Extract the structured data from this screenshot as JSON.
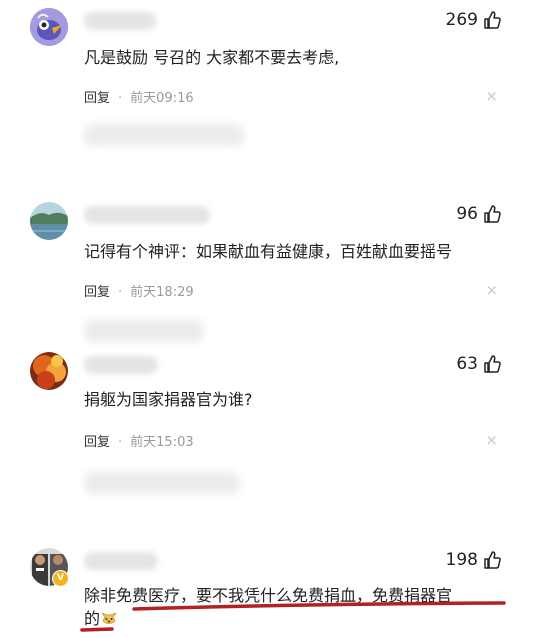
{
  "colors": {
    "text": "#222222",
    "meta": "#999999",
    "underline_annotation": "#b22222",
    "verified_badge": "#f3b320"
  },
  "comments": [
    {
      "likes": "269",
      "content": "凡是鼓励 号召的 大家都不要去考虑,",
      "reply_label": "回复",
      "separator": "·",
      "time": "前天09:16",
      "close_symbol": "×",
      "avatar_icon": "cartoon-bird-avatar"
    },
    {
      "likes": "96",
      "content": "记得有个神评：如果献血有益健康，百姓献血要摇号",
      "reply_label": "回复",
      "separator": "·",
      "time": "前天18:29",
      "close_symbol": "×",
      "avatar_icon": "lake-landscape-avatar"
    },
    {
      "likes": "63",
      "content": "捐躯为国家捐器官为谁?",
      "reply_label": "回复",
      "separator": "·",
      "time": "前天15:03",
      "close_symbol": "×",
      "avatar_icon": "autumn-leaves-avatar"
    },
    {
      "likes": "198",
      "content_line1": "除非免费医疗，要不我凭什么免费捐血，免费捐器官",
      "content_line2": "的",
      "avatar_icon": "people-photo-avatar",
      "badge": "V"
    }
  ]
}
